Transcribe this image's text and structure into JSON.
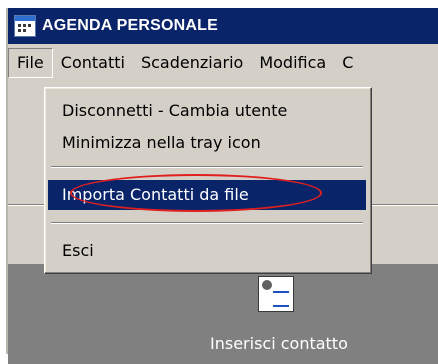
{
  "window": {
    "title": "AGENDA PERSONALE"
  },
  "menubar": {
    "items": [
      {
        "label": "File"
      },
      {
        "label": "Contatti"
      },
      {
        "label": "Scadenziario"
      },
      {
        "label": "Modifica"
      },
      {
        "label": "C"
      }
    ]
  },
  "file_menu": {
    "items": [
      {
        "label": "Disconnetti - Cambia utente"
      },
      {
        "label": "Minimizza nella tray icon"
      },
      {
        "label": "Importa Contatti da file"
      },
      {
        "label": "Esci"
      }
    ]
  },
  "annotation": {
    "color": "#e0201f"
  },
  "panel": {
    "contact_label": "Inserisci contatto"
  },
  "colors": {
    "titlebar": "#0a246a",
    "selection": "#0a246a",
    "face": "#d4d0c8",
    "panel": "#808080"
  }
}
